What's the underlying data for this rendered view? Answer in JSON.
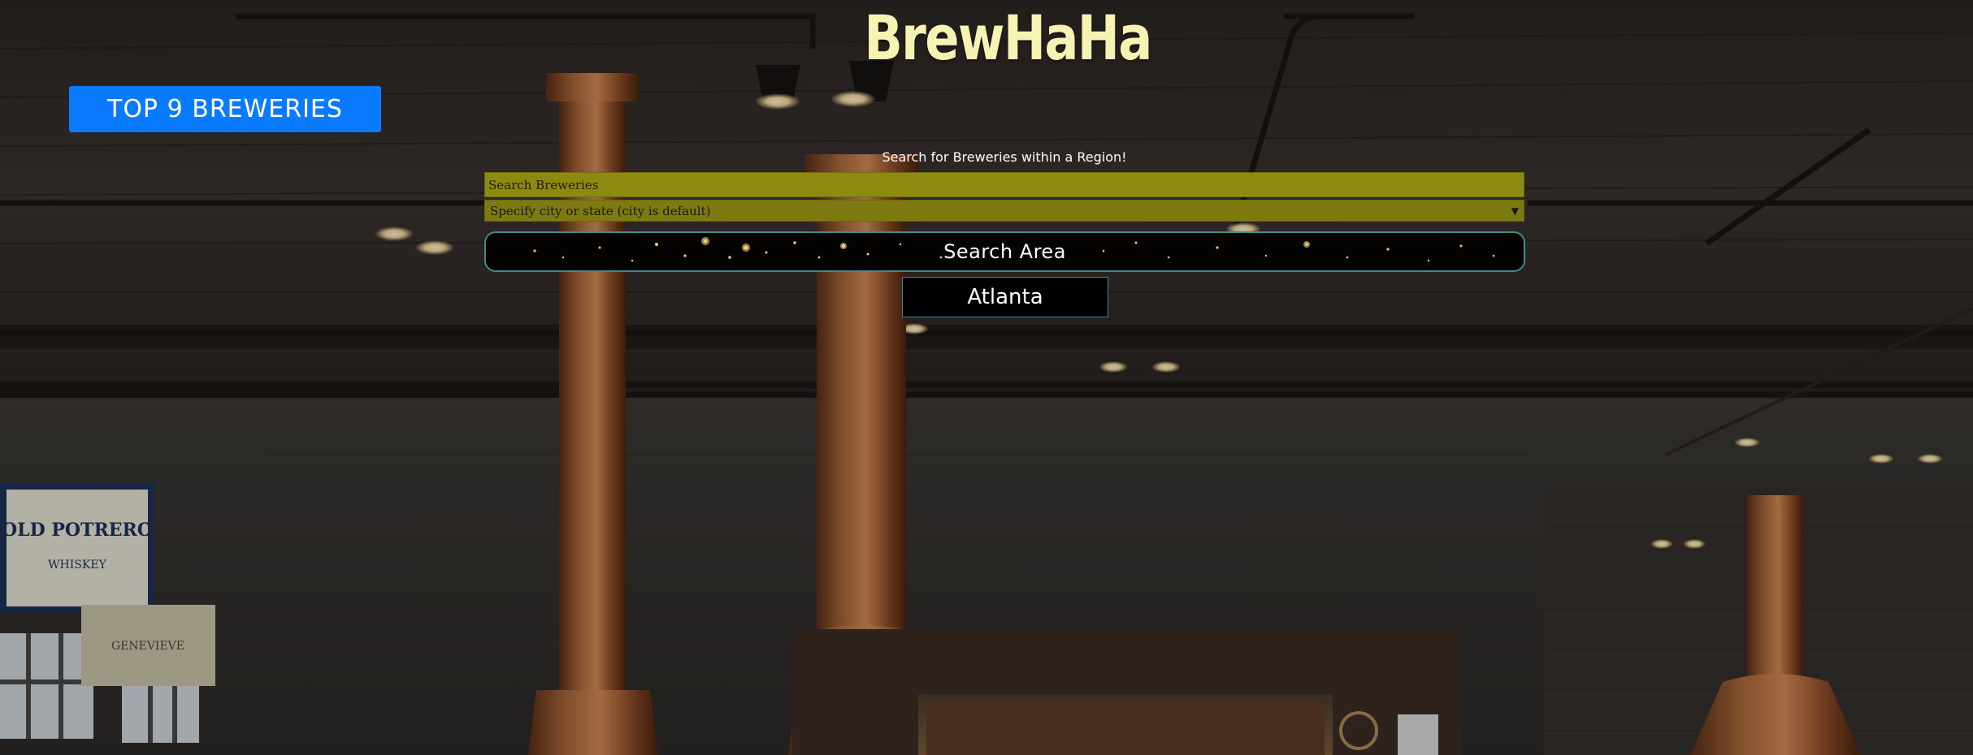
{
  "header": {
    "logo_text": "BrewHaHa",
    "top_button_label": "TOP 9 BREWERIES"
  },
  "search": {
    "heading": "Search for Breweries within a Region!",
    "input_placeholder": "Search Breweries",
    "region_select_value": "Specify city or state (city is default)",
    "search_button_label": "Search Area"
  },
  "results": {
    "city": "Atlanta"
  },
  "background": {
    "banner_1": "OLD POTRERO",
    "banner_1_sub": "WHISKEY",
    "banner_2": "GENEVIEVE"
  },
  "colors": {
    "top_button": "#0a7bff",
    "logo": "#f6f3b4",
    "input_fill": "#8c8a10",
    "button_border": "#3f8b91"
  }
}
